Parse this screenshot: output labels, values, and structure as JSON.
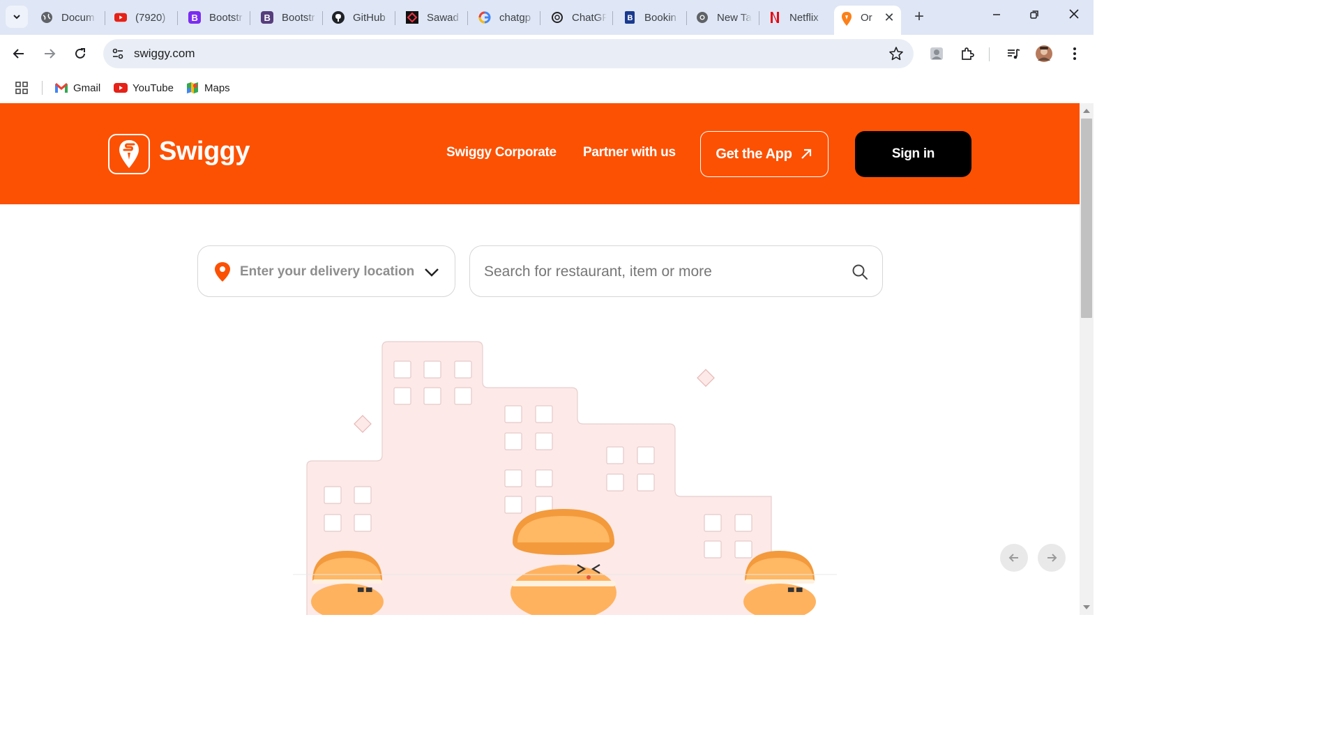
{
  "browser": {
    "tabs": [
      {
        "title": "Docum",
        "icon": "globe-icon"
      },
      {
        "title": "(7920)",
        "icon": "youtube-icon"
      },
      {
        "title": "Bootstr",
        "icon": "bootstrap-icon"
      },
      {
        "title": "Bootstr",
        "icon": "bootstrap-icon"
      },
      {
        "title": "GitHub",
        "icon": "github-icon"
      },
      {
        "title": "Sawad",
        "icon": "sawad-icon"
      },
      {
        "title": "chatgp",
        "icon": "google-icon"
      },
      {
        "title": "ChatGF",
        "icon": "openai-icon"
      },
      {
        "title": "Bookin",
        "icon": "booking-icon"
      },
      {
        "title": "New Ta",
        "icon": "chrome-icon"
      },
      {
        "title": "Netflix",
        "icon": "netflix-icon"
      }
    ],
    "active_tab": {
      "title": "Or",
      "icon": "swiggy-icon",
      "close": "✕"
    },
    "new_tab": "+",
    "url": "swiggy.com",
    "bookmarks": [
      {
        "label": "Gmail",
        "icon": "gmail-icon"
      },
      {
        "label": "YouTube",
        "icon": "youtube-icon"
      },
      {
        "label": "Maps",
        "icon": "maps-icon"
      }
    ]
  },
  "header": {
    "brand": "Swiggy",
    "nav": {
      "corporate": "Swiggy Corporate",
      "partner": "Partner with us",
      "get_app": "Get the App",
      "sign_in": "Sign in"
    }
  },
  "search": {
    "location_placeholder": "Enter your delivery location",
    "search_placeholder": "Search for restaurant, item or more"
  },
  "colors": {
    "brand_orange": "#fc5103",
    "sign_in_bg": "#000000",
    "building_pink": "#fde9e8"
  }
}
